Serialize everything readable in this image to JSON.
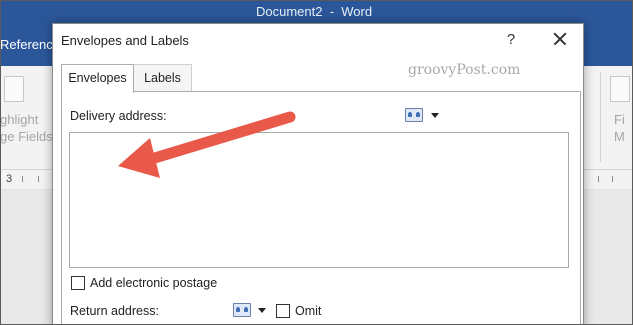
{
  "window": {
    "title": "Document2  -  Word",
    "ribbon_tab_partial": "Referenc"
  },
  "ribbon": {
    "left_ghost_lines": [
      "ghlight",
      "ge Fields"
    ],
    "right_ghost_lines": [
      "Fi",
      "M"
    ],
    "ruler_number": "3"
  },
  "dialog": {
    "title": "Envelopes and Labels",
    "help_label": "?",
    "tabs": [
      {
        "label": "Envelopes",
        "active": true
      },
      {
        "label": "Labels",
        "active": false
      }
    ],
    "delivery_address_label": "Delivery address:",
    "delivery_address_value": "",
    "add_postage_label": "Add electronic postage",
    "add_postage_checked": false,
    "return_address_label": "Return address:",
    "omit_label": "Omit",
    "omit_checked": false
  },
  "watermark": "groovyPost.com",
  "colors": {
    "word_blue": "#2b579a",
    "arrow": "#e8594a"
  }
}
